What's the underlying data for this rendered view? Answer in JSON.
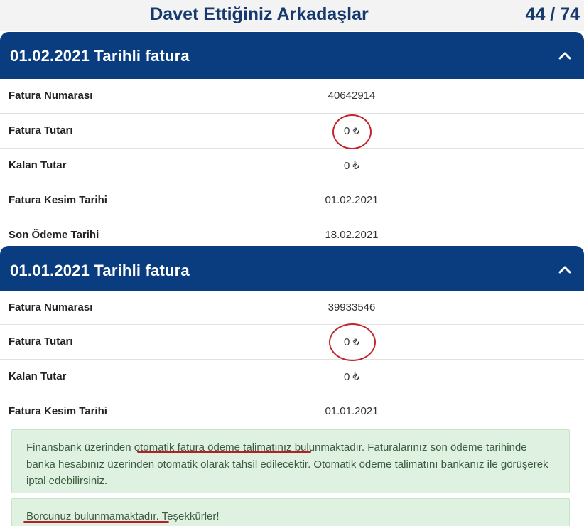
{
  "header": {
    "title": "Davet Ettiğiniz Arkadaşlar",
    "counter": "44 / 74"
  },
  "invoices": [
    {
      "title": "01.02.2021 Tarihli fatura",
      "rows": [
        {
          "label": "Fatura Numarası",
          "value": "40642914"
        },
        {
          "label": "Fatura Tutarı",
          "value": "0 ₺"
        },
        {
          "label": "Kalan Tutar",
          "value": "0 ₺"
        },
        {
          "label": "Fatura Kesim Tarihi",
          "value": "01.02.2021"
        },
        {
          "label": "Son Ödeme Tarihi",
          "value": "18.02.2021"
        }
      ]
    },
    {
      "title": "01.01.2021 Tarihli fatura",
      "rows": [
        {
          "label": "Fatura Numarası",
          "value": "39933546"
        },
        {
          "label": "Fatura Tutarı",
          "value": "0 ₺"
        },
        {
          "label": "Kalan Tutar",
          "value": "0 ₺"
        },
        {
          "label": "Fatura Kesim Tarihi",
          "value": "01.01.2021"
        }
      ]
    }
  ],
  "notices": {
    "autopay": {
      "prefix": "Finansbank üzerinden ",
      "highlight": "otomatik fatura ödeme talimatınız",
      "suffix": " bulunmaktadır. Faturalarınız son ödeme tarihinde banka hesabınız üzerinden otomatik olarak tahsil edilecektir. Otomatik ödeme talimatını bankanız ile görüşerek iptal edebilirsiniz."
    },
    "debt": {
      "highlight": "Borcunuz bulunmamaktadır",
      "suffix": ". Teşekkürler!"
    }
  },
  "icons": {
    "collapse": "chevron-up-icon"
  },
  "colors": {
    "header_blue": "#0a3d80",
    "title_blue": "#163a6e",
    "notice_bg": "#dff1e0",
    "annotation_red": "#c0262d"
  }
}
